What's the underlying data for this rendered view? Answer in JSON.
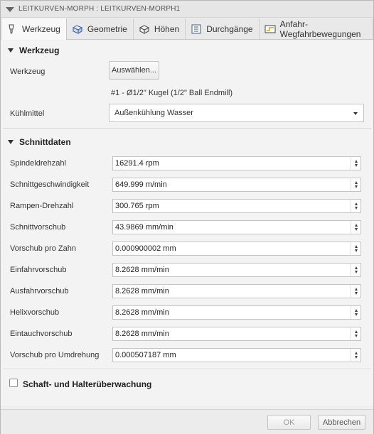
{
  "window": {
    "title": "LEITKURVEN-MORPH : LEITKURVEN-MORPH1"
  },
  "tabs": [
    {
      "label": "Werkzeug",
      "icon": "tool-icon"
    },
    {
      "label": "Geometrie",
      "icon": "geometry-icon"
    },
    {
      "label": "Höhen",
      "icon": "heights-icon"
    },
    {
      "label": "Durchgänge",
      "icon": "passes-icon"
    },
    {
      "label": "Anfahr-Wegfahrbewegungen",
      "icon": "linking-icon"
    }
  ],
  "tool_section": {
    "header": "Werkzeug",
    "tool_label": "Werkzeug",
    "select_button": "Auswählen...",
    "tool_description": "#1 - Ø1/2\" Kugel (1/2\" Ball Endmill)",
    "coolant_label": "Kühlmittel",
    "coolant_value": "Außenkühlung Wasser"
  },
  "cutting_section": {
    "header": "Schnittdaten",
    "fields": [
      {
        "label": "Spindeldrehzahl",
        "value": "16291.4 rpm"
      },
      {
        "label": "Schnittgeschwindigkeit",
        "value": "649.999 m/min"
      },
      {
        "label": "Rampen-Drehzahl",
        "value": "300.765 rpm"
      },
      {
        "label": "Schnittvorschub",
        "value": "43.9869 mm/min"
      },
      {
        "label": "Vorschub pro Zahn",
        "value": "0.000900002 mm"
      },
      {
        "label": "Einfahrvorschub",
        "value": "8.2628 mm/min"
      },
      {
        "label": "Ausfahrvorschub",
        "value": "8.2628 mm/min"
      },
      {
        "label": "Helixvorschub",
        "value": "8.2628 mm/min"
      },
      {
        "label": "Eintauchvorschub",
        "value": "8.2628 mm/min"
      },
      {
        "label": "Vorschub pro Umdrehung",
        "value": "0.000507187 mm"
      }
    ]
  },
  "shaft_section": {
    "header": "Schaft- und Halterüberwachung",
    "checked": false
  },
  "footer": {
    "ok": "OK",
    "cancel": "Abbrechen"
  }
}
